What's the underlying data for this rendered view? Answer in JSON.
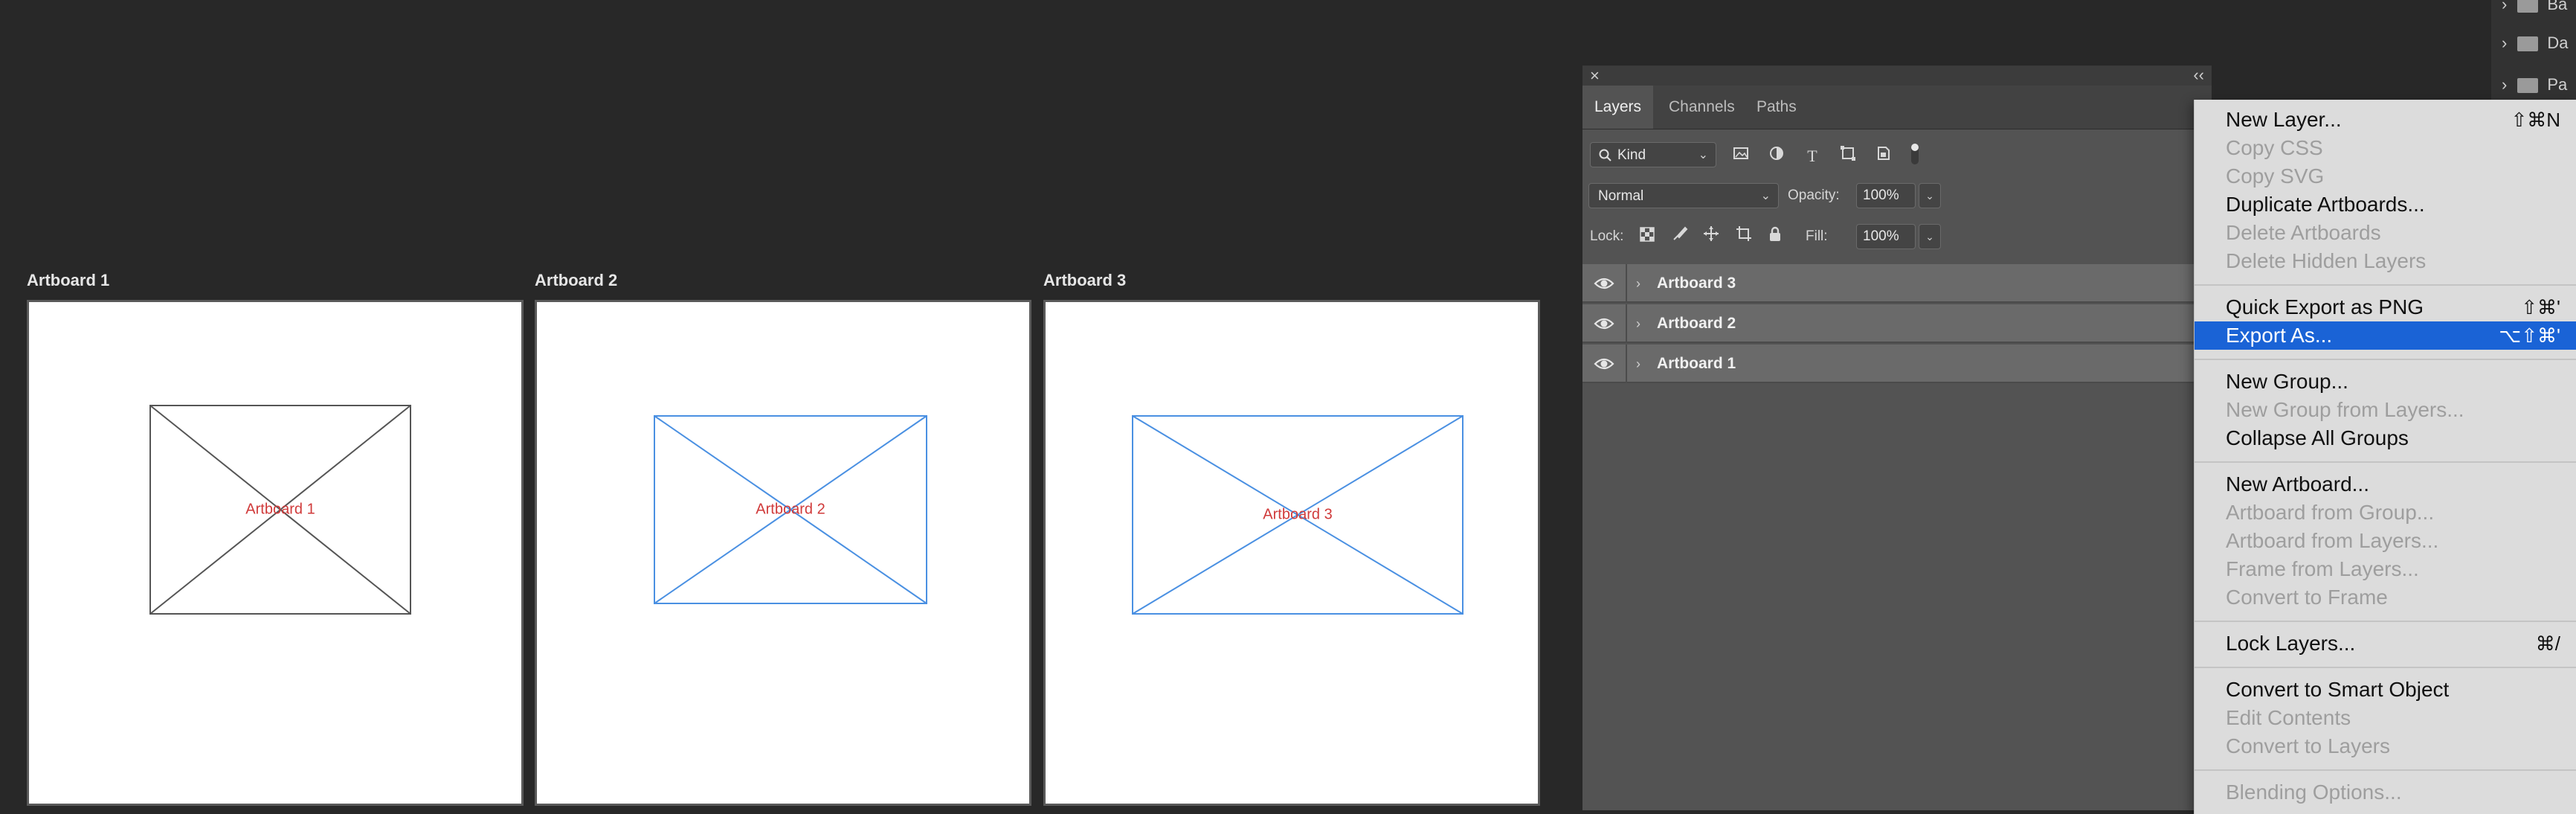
{
  "canvas": {
    "artboards": [
      {
        "title": "Artboard 1",
        "placeholder_label": "Artboard 1",
        "frame_color": "#555555"
      },
      {
        "title": "Artboard 2",
        "placeholder_label": "Artboard 2",
        "frame_color": "#4a90e2"
      },
      {
        "title": "Artboard 3",
        "placeholder_label": "Artboard 3",
        "frame_color": "#4a90e2"
      }
    ]
  },
  "panel": {
    "close_glyph": "×",
    "collapse_glyph": "‹‹",
    "tabs": [
      {
        "label": "Layers",
        "active": true
      },
      {
        "label": "Channels",
        "active": false
      },
      {
        "label": "Paths",
        "active": false
      }
    ],
    "filter": {
      "kind_value": "Kind",
      "icons": [
        "pixel-filter-icon",
        "adjustment-filter-icon",
        "type-filter-icon",
        "shape-filter-icon",
        "smart-object-filter-icon",
        "filter-toggle-icon"
      ]
    },
    "blend": {
      "mode_value": "Normal",
      "opacity_label": "Opacity:",
      "opacity_value": "100%"
    },
    "lock": {
      "label": "Lock:",
      "icons": [
        "lock-transparent-pixels-icon",
        "lock-image-pixels-icon",
        "lock-position-icon",
        "lock-artboard-icon",
        "lock-all-icon"
      ],
      "fill_label": "Fill:",
      "fill_value": "100%"
    },
    "layers": [
      {
        "name": "Artboard 3"
      },
      {
        "name": "Artboard 2"
      },
      {
        "name": "Artboard 1"
      }
    ]
  },
  "background_panel": {
    "items": [
      {
        "label": "Ba"
      },
      {
        "label": "Da"
      },
      {
        "label": "Pa"
      }
    ]
  },
  "context_menu": {
    "groups": [
      [
        {
          "label": "New Layer...",
          "shortcut": "⇧⌘N",
          "enabled": true
        },
        {
          "label": "Copy CSS",
          "shortcut": "",
          "enabled": false
        },
        {
          "label": "Copy SVG",
          "shortcut": "",
          "enabled": false
        },
        {
          "label": "Duplicate Artboards...",
          "shortcut": "",
          "enabled": true
        },
        {
          "label": "Delete Artboards",
          "shortcut": "",
          "enabled": false
        },
        {
          "label": "Delete Hidden Layers",
          "shortcut": "",
          "enabled": false
        }
      ],
      [
        {
          "label": "Quick Export as PNG",
          "shortcut": "⇧⌘'",
          "enabled": true
        },
        {
          "label": "Export As...",
          "shortcut": "⌥⇧⌘'",
          "enabled": true,
          "selected": true
        }
      ],
      [
        {
          "label": "New Group...",
          "shortcut": "",
          "enabled": true
        },
        {
          "label": "New Group from Layers...",
          "shortcut": "",
          "enabled": false
        },
        {
          "label": "Collapse All Groups",
          "shortcut": "",
          "enabled": true
        }
      ],
      [
        {
          "label": "New Artboard...",
          "shortcut": "",
          "enabled": true
        },
        {
          "label": "Artboard from Group...",
          "shortcut": "",
          "enabled": false
        },
        {
          "label": "Artboard from Layers...",
          "shortcut": "",
          "enabled": false
        },
        {
          "label": "Frame from Layers...",
          "shortcut": "",
          "enabled": false
        },
        {
          "label": "Convert to Frame",
          "shortcut": "",
          "enabled": false
        }
      ],
      [
        {
          "label": "Lock Layers...",
          "shortcut": "⌘/",
          "enabled": true
        }
      ],
      [
        {
          "label": "Convert to Smart Object",
          "shortcut": "",
          "enabled": true
        },
        {
          "label": "Edit Contents",
          "shortcut": "",
          "enabled": false
        },
        {
          "label": "Convert to Layers",
          "shortcut": "",
          "enabled": false
        }
      ],
      [
        {
          "label": "Blending Options...",
          "shortcut": "",
          "enabled": false
        }
      ]
    ],
    "selected_color": "#1a63d6"
  }
}
